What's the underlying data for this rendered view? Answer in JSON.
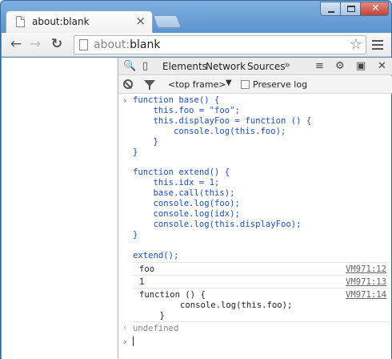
{
  "browser": {
    "tab_title": "about:blank",
    "tab_close": "×",
    "url_scheme": "about:",
    "url_rest": "blank",
    "star": "☆",
    "close_glyph": "✕"
  },
  "devtools": {
    "tabs": [
      "Elements",
      "Network",
      "Sources"
    ],
    "more": "»",
    "frame": "<top frame>",
    "preserve_log": "Preserve log",
    "frame_arrow": "▼"
  },
  "console": {
    "code_lines": [
      "function base() {",
      "    this.foo = \"foo\";",
      "    this.displayFoo = function () {",
      "        console.log(this.foo);",
      "    }",
      "}",
      "",
      "function extend() {",
      "    this.idx = 1;",
      "    base.call(this);",
      "    console.log(foo);",
      "    console.log(idx);",
      "    console.log(this.displayFoo);",
      "}",
      "",
      "extend();"
    ],
    "outputs": [
      {
        "text": "foo",
        "source": "VM971:12",
        "kind": "string"
      },
      {
        "text": "1",
        "source": "VM971:13",
        "kind": "number"
      },
      {
        "text": "function () {\n        console.log(this.foo);\n    }",
        "source": "VM971:14",
        "kind": "string"
      }
    ],
    "result": "undefined",
    "prompt_glyph": "›",
    "result_glyph": "‹"
  }
}
